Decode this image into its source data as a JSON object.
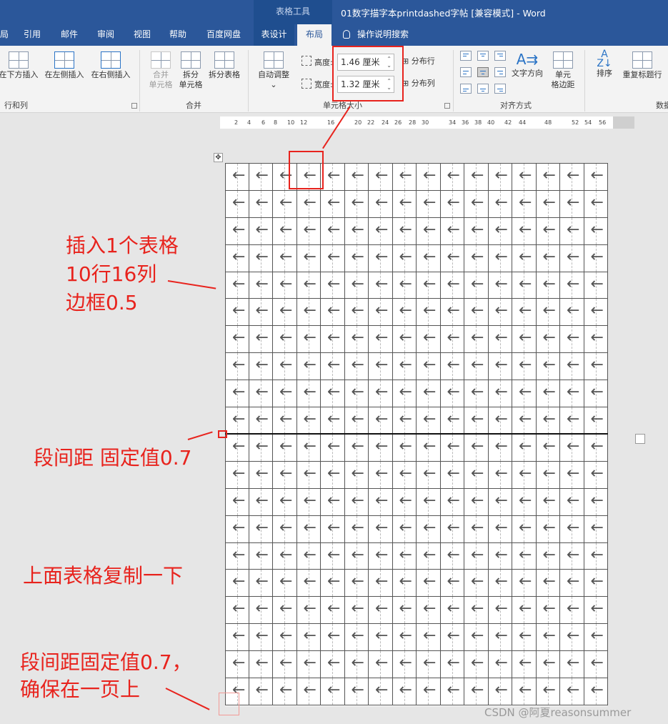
{
  "window": {
    "context_tab": "表格工具",
    "title": "01数字描字本printdashed字帖 [兼容模式]  -  Word"
  },
  "tabs": [
    {
      "label": "局"
    },
    {
      "label": "引用"
    },
    {
      "label": "邮件"
    },
    {
      "label": "审阅"
    },
    {
      "label": "视图"
    },
    {
      "label": "帮助"
    },
    {
      "label": "百度网盘"
    },
    {
      "label": "表设计"
    },
    {
      "label": "布局",
      "active": true
    }
  ],
  "tell_me": "操作说明搜索",
  "ribbon": {
    "rows_cols": {
      "insert_below": "在下方插入",
      "insert_left": "在左侧插入",
      "insert_right": "在右侧插入",
      "group": "行和列"
    },
    "merge": {
      "merge_cells_1": "合并",
      "merge_cells_2": "单元格",
      "split_cells_1": "拆分",
      "split_cells_2": "单元格",
      "split_table": "拆分表格",
      "group": "合并"
    },
    "cell_size": {
      "autofit": "自动调整",
      "height_label": "高度:",
      "height_value": "1.46 厘米",
      "width_label": "宽度:",
      "width_value": "1.32 厘米",
      "distribute_rows": "分布行",
      "distribute_cols": "分布列",
      "group": "单元格大小"
    },
    "alignment": {
      "text_direction": "文字方向",
      "cell_margins_1": "单元",
      "cell_margins_2": "格边距",
      "group": "对齐方式"
    },
    "data": {
      "sort": "排序",
      "repeat_header": "重复标题行",
      "group": "数据"
    }
  },
  "ruler_ticks": [
    "2",
    "4",
    "6",
    "8",
    "10",
    "12",
    "16",
    "20",
    "22",
    "24",
    "26",
    "28",
    "30",
    "34",
    "36",
    "38",
    "40",
    "42",
    "44",
    "48",
    "52",
    "54",
    "56"
  ],
  "table": {
    "rows_per_table": 10,
    "cols": 16,
    "cell_glyph": "←"
  },
  "annotations": {
    "note1_line1": "插入1个表格",
    "note1_line2": "10行16列",
    "note1_line3": "边框0.5",
    "note2": "段间距 固定值0.7",
    "note3": "上面表格复制一下",
    "note4_line1": "段间距固定值0.7，",
    "note4_line2": "确保在一页上",
    "color": "#e8231d"
  },
  "watermark": "CSDN @阿夏reasonsummer"
}
